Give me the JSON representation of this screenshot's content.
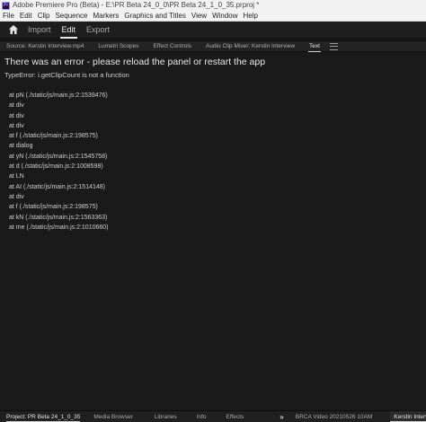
{
  "window": {
    "title": "Adobe Premiere Pro (Beta) - E:\\PR Beta 24_0_0\\PR Beta 24_1_0_35.prproj *",
    "logo_text": "Pr"
  },
  "menu": [
    "File",
    "Edit",
    "Clip",
    "Sequence",
    "Markers",
    "Graphics and Titles",
    "View",
    "Window",
    "Help"
  ],
  "workspace": {
    "home_icon": "home-icon",
    "tabs": [
      "Import",
      "Edit",
      "Export"
    ],
    "active_tab": "Edit"
  },
  "panel_tabs": {
    "items": [
      "Source: Kerstin Interview.mp4",
      "Lumetri Scopes",
      "Effect Controls",
      "Audio Clip Mixer: Kerstin Interview",
      "Text"
    ],
    "active": "Text",
    "menu_icon": "panel-menu-icon"
  },
  "error": {
    "title": "There was an error - please reload the panel or restart the app",
    "type": "TypeError: i.getClipCount is not a function",
    "stack": [
      "at pN (./static/js/main.js:2:1539476)",
      "at div",
      "at div",
      "at div",
      "at f (./static/js/main.js:2:198575)",
      "at dialog",
      "at yN (./static/js/main.js:2:1545758)",
      "at d (./static/js/main.js:2:1008598)",
      "at LN",
      "at AI (./static/js/main.js:2:1514148)",
      "at div",
      "at f (./static/js/main.js:2:198575)",
      "at kN (./static/js/main.js:2:1563363)",
      "at me (./static/js/main.js:2:1010660)"
    ]
  },
  "bottom": {
    "tabs": [
      "Project: PR Beta 24_1_0_35",
      "Media Browser",
      "Libraries",
      "Info",
      "Effects"
    ],
    "overflow_label": "»",
    "sequence_tabs": [
      "BRCA Video 20210526 10AM",
      "Kerstin Interv"
    ]
  },
  "colors": {
    "background": "#1a1a1a",
    "titlebar": "#f2f2f2",
    "text": "#d4d4d4"
  }
}
